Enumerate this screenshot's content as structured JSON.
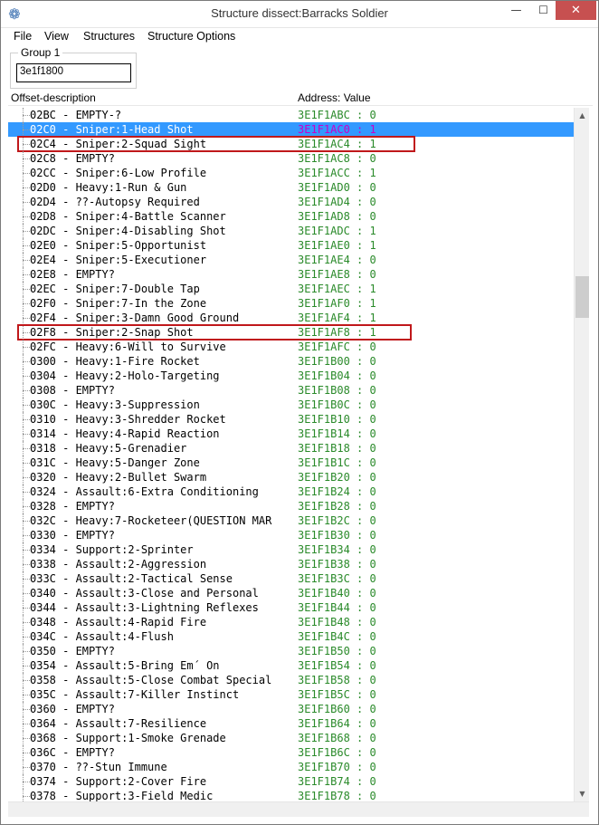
{
  "window": {
    "title": "Structure dissect:Barracks Soldier",
    "icon": "cheat-engine-icon",
    "minimize_glyph": "—",
    "maximize_glyph": "☐",
    "close_glyph": "✕"
  },
  "menu": [
    "File",
    "View",
    "Structures",
    "Structure Options"
  ],
  "group": {
    "label": "Group 1",
    "address": "3e1f1800"
  },
  "columns": {
    "offset_description": "Offset-description",
    "address_value": "Address: Value"
  },
  "colors": {
    "selected_bg": "#3399ff",
    "value_text": "#2a8a2a",
    "highlight_border": "#c0181b"
  },
  "rows": [
    {
      "desc": "02BC - EMPTY-?",
      "val": "3E1F1ABC : 0"
    },
    {
      "desc": "02C0 - Sniper:1-Head Shot",
      "val": "3E1F1AC0 : 1",
      "selected": true
    },
    {
      "desc": "02C4 - Sniper:2-Squad Sight",
      "val": "3E1F1AC4 : 1",
      "boxed": true
    },
    {
      "desc": "02C8 - EMPTY?",
      "val": "3E1F1AC8 : 0"
    },
    {
      "desc": "02CC - Sniper:6-Low Profile",
      "val": "3E1F1ACC : 1"
    },
    {
      "desc": "02D0 - Heavy:1-Run & Gun",
      "val": "3E1F1AD0 : 0"
    },
    {
      "desc": "02D4 - ??-Autopsy Required",
      "val": "3E1F1AD4 : 0"
    },
    {
      "desc": "02D8 - Sniper:4-Battle Scanner",
      "val": "3E1F1AD8 : 0"
    },
    {
      "desc": "02DC - Sniper:4-Disabling Shot",
      "val": "3E1F1ADC : 1"
    },
    {
      "desc": "02E0 - Sniper:5-Opportunist",
      "val": "3E1F1AE0 : 1"
    },
    {
      "desc": "02E4 - Sniper:5-Executioner",
      "val": "3E1F1AE4 : 0"
    },
    {
      "desc": "02E8 - EMPTY?",
      "val": "3E1F1AE8 : 0"
    },
    {
      "desc": "02EC - Sniper:7-Double Tap",
      "val": "3E1F1AEC : 1"
    },
    {
      "desc": "02F0 - Sniper:7-In the Zone",
      "val": "3E1F1AF0 : 1"
    },
    {
      "desc": "02F4 - Sniper:3-Damn Good Ground",
      "val": "3E1F1AF4 : 1"
    },
    {
      "desc": "02F8 - Sniper:2-Snap Shot",
      "val": "3E1F1AF8 : 1",
      "boxed": true
    },
    {
      "desc": "02FC - Heavy:6-Will to Survive",
      "val": "3E1F1AFC : 0"
    },
    {
      "desc": "0300 - Heavy:1-Fire Rocket",
      "val": "3E1F1B00 : 0"
    },
    {
      "desc": "0304 - Heavy:2-Holo-Targeting",
      "val": "3E1F1B04 : 0"
    },
    {
      "desc": "0308 - EMPTY?",
      "val": "3E1F1B08 : 0"
    },
    {
      "desc": "030C - Heavy:3-Suppression",
      "val": "3E1F1B0C : 0"
    },
    {
      "desc": "0310 - Heavy:3-Shredder Rocket",
      "val": "3E1F1B10 : 0"
    },
    {
      "desc": "0314 - Heavy:4-Rapid Reaction",
      "val": "3E1F1B14 : 0"
    },
    {
      "desc": "0318 - Heavy:5-Grenadier",
      "val": "3E1F1B18 : 0"
    },
    {
      "desc": "031C - Heavy:5-Danger Zone",
      "val": "3E1F1B1C : 0"
    },
    {
      "desc": "0320 - Heavy:2-Bullet Swarm",
      "val": "3E1F1B20 : 0"
    },
    {
      "desc": "0324 - Assault:6-Extra Conditioning",
      "val": "3E1F1B24 : 0"
    },
    {
      "desc": "0328 - EMPTY?",
      "val": "3E1F1B28 : 0"
    },
    {
      "desc": "032C - Heavy:7-Rocketeer(QUESTION MAR",
      "val": "3E1F1B2C : 0"
    },
    {
      "desc": "0330 - EMPTY?",
      "val": "3E1F1B30 : 0"
    },
    {
      "desc": "0334 - Support:2-Sprinter",
      "val": "3E1F1B34 : 0"
    },
    {
      "desc": "0338 - Assault:2-Aggression",
      "val": "3E1F1B38 : 0"
    },
    {
      "desc": "033C - Assault:2-Tactical Sense",
      "val": "3E1F1B3C : 0"
    },
    {
      "desc": "0340 - Assault:3-Close and Personal",
      "val": "3E1F1B40 : 0"
    },
    {
      "desc": "0344 - Assault:3-Lightning Reflexes",
      "val": "3E1F1B44 : 0"
    },
    {
      "desc": "0348 - Assault:4-Rapid Fire",
      "val": "3E1F1B48 : 0"
    },
    {
      "desc": "034C - Assault:4-Flush",
      "val": "3E1F1B4C : 0"
    },
    {
      "desc": "0350 - EMPTY?",
      "val": "3E1F1B50 : 0"
    },
    {
      "desc": "0354 - Assault:5-Bring Em´ On",
      "val": "3E1F1B54 : 0"
    },
    {
      "desc": "0358 - Assault:5-Close Combat Special",
      "val": "3E1F1B58 : 0"
    },
    {
      "desc": "035C - Assault:7-Killer Instinct",
      "val": "3E1F1B5C : 0"
    },
    {
      "desc": "0360 - EMPTY?",
      "val": "3E1F1B60 : 0"
    },
    {
      "desc": "0364 - Assault:7-Resilience",
      "val": "3E1F1B64 : 0"
    },
    {
      "desc": "0368 - Support:1-Smoke Grenade",
      "val": "3E1F1B68 : 0"
    },
    {
      "desc": "036C - EMPTY?",
      "val": "3E1F1B6C : 0"
    },
    {
      "desc": "0370 - ??-Stun Immune",
      "val": "3E1F1B70 : 0"
    },
    {
      "desc": "0374 - Support:2-Cover Fire",
      "val": "3E1F1B74 : 0"
    },
    {
      "desc": "0378 - Support:3-Field Medic",
      "val": "3E1F1B78 : 0"
    }
  ],
  "scrollbar": {
    "up_glyph": "▲",
    "down_glyph": "▼"
  }
}
